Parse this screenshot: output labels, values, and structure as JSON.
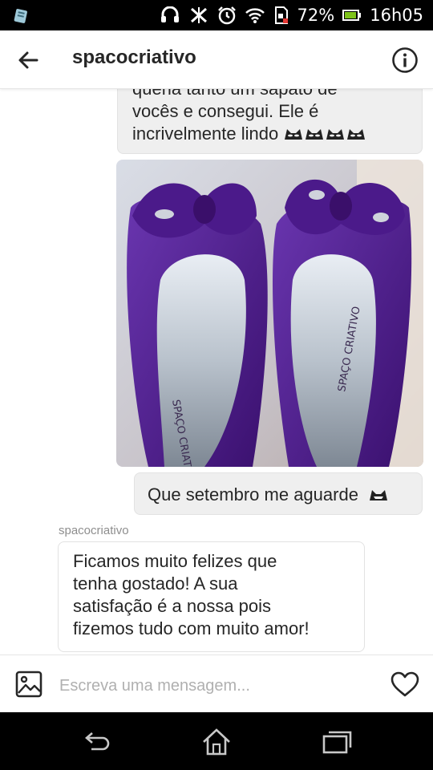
{
  "status_bar": {
    "battery": "72%",
    "time": "16h05",
    "icons": [
      "clipboard-icon",
      "headset-icon",
      "signal-off-icon",
      "alarm-icon",
      "wifi-icon",
      "sim-icon",
      "battery-icon"
    ]
  },
  "header": {
    "title": "spacocriativo",
    "back_icon": "arrow-left-icon",
    "info_icon": "info-icon"
  },
  "thread": {
    "incoming_top": {
      "line1": "queria tanto um sapato de",
      "line2": "vocês e consegui. Ele é",
      "line3": "incrivelmente lindo"
    },
    "photo": {
      "brand_left": "SPAÇO CRIATIVO",
      "brand_right": "SPAÇO CRIATIVO"
    },
    "outgoing": {
      "text": "Que setembro me aguarde"
    },
    "reply": {
      "sender": "spacocriativo",
      "line1": "Ficamos muito felizes que",
      "line2": "tenha gostado! A sua",
      "line3": "satisfação é a nossa pois",
      "line4": "fizemos tudo com muito amor!"
    }
  },
  "composer": {
    "placeholder": "Escreva uma mensagem...",
    "gallery_icon": "image-icon",
    "heart_icon": "heart-icon"
  },
  "nav_bar": {
    "icons": [
      "back-icon",
      "home-icon",
      "recents-icon"
    ]
  },
  "colors": {
    "bubble": "#efefef",
    "text": "#262626",
    "muted": "#8e8e8e",
    "shoe_purple": "#4b1a8a"
  }
}
